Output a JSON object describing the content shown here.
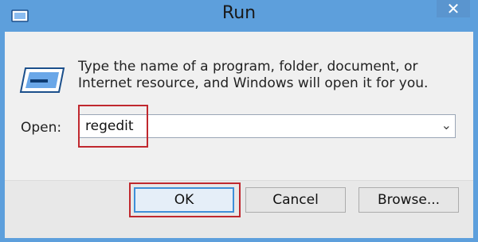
{
  "window": {
    "title": "Run",
    "close_glyph": "✕",
    "accent_color": "#5d9fdc",
    "highlight_color": "#c0282e"
  },
  "dialog": {
    "description": "Type the name of a program, folder, document, or Internet resource, and Windows will open it for you.",
    "open_label": "Open:",
    "open_value": "regedit",
    "dropdown_glyph": "⌄"
  },
  "buttons": {
    "ok": "OK",
    "cancel": "Cancel",
    "browse": "Browse..."
  },
  "icons": {
    "title_icon": "run-app-icon",
    "main_icon": "run-window-icon",
    "dropdown": "chevron-down-icon",
    "close": "close-icon"
  }
}
